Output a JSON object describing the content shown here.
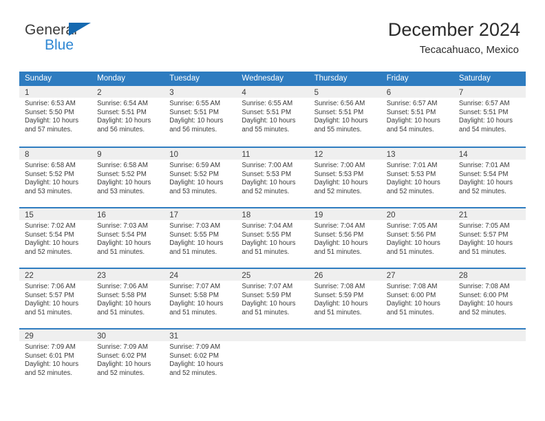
{
  "brand": {
    "line1": "General",
    "line2": "Blue",
    "triangle_color": "#1569b0",
    "blue_text_color": "#2f87d3"
  },
  "header": {
    "title": "December 2024",
    "subtitle": "Tecacahuaco, Mexico"
  },
  "theme": {
    "header_blue": "#2e7cc0",
    "daynum_strip": "#efefef",
    "text": "#3a3a3a"
  },
  "weekdays": [
    "Sunday",
    "Monday",
    "Tuesday",
    "Wednesday",
    "Thursday",
    "Friday",
    "Saturday"
  ],
  "labels": {
    "sunrise_prefix": "Sunrise:",
    "sunset_prefix": "Sunset:",
    "daylight_prefix": "Daylight:"
  },
  "weeks": [
    [
      {
        "day": "1",
        "sunrise": "Sunrise: 6:53 AM",
        "sunset": "Sunset: 5:50 PM",
        "daylight1": "Daylight: 10 hours",
        "daylight2": "and 57 minutes."
      },
      {
        "day": "2",
        "sunrise": "Sunrise: 6:54 AM",
        "sunset": "Sunset: 5:51 PM",
        "daylight1": "Daylight: 10 hours",
        "daylight2": "and 56 minutes."
      },
      {
        "day": "3",
        "sunrise": "Sunrise: 6:55 AM",
        "sunset": "Sunset: 5:51 PM",
        "daylight1": "Daylight: 10 hours",
        "daylight2": "and 56 minutes."
      },
      {
        "day": "4",
        "sunrise": "Sunrise: 6:55 AM",
        "sunset": "Sunset: 5:51 PM",
        "daylight1": "Daylight: 10 hours",
        "daylight2": "and 55 minutes."
      },
      {
        "day": "5",
        "sunrise": "Sunrise: 6:56 AM",
        "sunset": "Sunset: 5:51 PM",
        "daylight1": "Daylight: 10 hours",
        "daylight2": "and 55 minutes."
      },
      {
        "day": "6",
        "sunrise": "Sunrise: 6:57 AM",
        "sunset": "Sunset: 5:51 PM",
        "daylight1": "Daylight: 10 hours",
        "daylight2": "and 54 minutes."
      },
      {
        "day": "7",
        "sunrise": "Sunrise: 6:57 AM",
        "sunset": "Sunset: 5:51 PM",
        "daylight1": "Daylight: 10 hours",
        "daylight2": "and 54 minutes."
      }
    ],
    [
      {
        "day": "8",
        "sunrise": "Sunrise: 6:58 AM",
        "sunset": "Sunset: 5:52 PM",
        "daylight1": "Daylight: 10 hours",
        "daylight2": "and 53 minutes."
      },
      {
        "day": "9",
        "sunrise": "Sunrise: 6:58 AM",
        "sunset": "Sunset: 5:52 PM",
        "daylight1": "Daylight: 10 hours",
        "daylight2": "and 53 minutes."
      },
      {
        "day": "10",
        "sunrise": "Sunrise: 6:59 AM",
        "sunset": "Sunset: 5:52 PM",
        "daylight1": "Daylight: 10 hours",
        "daylight2": "and 53 minutes."
      },
      {
        "day": "11",
        "sunrise": "Sunrise: 7:00 AM",
        "sunset": "Sunset: 5:53 PM",
        "daylight1": "Daylight: 10 hours",
        "daylight2": "and 52 minutes."
      },
      {
        "day": "12",
        "sunrise": "Sunrise: 7:00 AM",
        "sunset": "Sunset: 5:53 PM",
        "daylight1": "Daylight: 10 hours",
        "daylight2": "and 52 minutes."
      },
      {
        "day": "13",
        "sunrise": "Sunrise: 7:01 AM",
        "sunset": "Sunset: 5:53 PM",
        "daylight1": "Daylight: 10 hours",
        "daylight2": "and 52 minutes."
      },
      {
        "day": "14",
        "sunrise": "Sunrise: 7:01 AM",
        "sunset": "Sunset: 5:54 PM",
        "daylight1": "Daylight: 10 hours",
        "daylight2": "and 52 minutes."
      }
    ],
    [
      {
        "day": "15",
        "sunrise": "Sunrise: 7:02 AM",
        "sunset": "Sunset: 5:54 PM",
        "daylight1": "Daylight: 10 hours",
        "daylight2": "and 52 minutes."
      },
      {
        "day": "16",
        "sunrise": "Sunrise: 7:03 AM",
        "sunset": "Sunset: 5:54 PM",
        "daylight1": "Daylight: 10 hours",
        "daylight2": "and 51 minutes."
      },
      {
        "day": "17",
        "sunrise": "Sunrise: 7:03 AM",
        "sunset": "Sunset: 5:55 PM",
        "daylight1": "Daylight: 10 hours",
        "daylight2": "and 51 minutes."
      },
      {
        "day": "18",
        "sunrise": "Sunrise: 7:04 AM",
        "sunset": "Sunset: 5:55 PM",
        "daylight1": "Daylight: 10 hours",
        "daylight2": "and 51 minutes."
      },
      {
        "day": "19",
        "sunrise": "Sunrise: 7:04 AM",
        "sunset": "Sunset: 5:56 PM",
        "daylight1": "Daylight: 10 hours",
        "daylight2": "and 51 minutes."
      },
      {
        "day": "20",
        "sunrise": "Sunrise: 7:05 AM",
        "sunset": "Sunset: 5:56 PM",
        "daylight1": "Daylight: 10 hours",
        "daylight2": "and 51 minutes."
      },
      {
        "day": "21",
        "sunrise": "Sunrise: 7:05 AM",
        "sunset": "Sunset: 5:57 PM",
        "daylight1": "Daylight: 10 hours",
        "daylight2": "and 51 minutes."
      }
    ],
    [
      {
        "day": "22",
        "sunrise": "Sunrise: 7:06 AM",
        "sunset": "Sunset: 5:57 PM",
        "daylight1": "Daylight: 10 hours",
        "daylight2": "and 51 minutes."
      },
      {
        "day": "23",
        "sunrise": "Sunrise: 7:06 AM",
        "sunset": "Sunset: 5:58 PM",
        "daylight1": "Daylight: 10 hours",
        "daylight2": "and 51 minutes."
      },
      {
        "day": "24",
        "sunrise": "Sunrise: 7:07 AM",
        "sunset": "Sunset: 5:58 PM",
        "daylight1": "Daylight: 10 hours",
        "daylight2": "and 51 minutes."
      },
      {
        "day": "25",
        "sunrise": "Sunrise: 7:07 AM",
        "sunset": "Sunset: 5:59 PM",
        "daylight1": "Daylight: 10 hours",
        "daylight2": "and 51 minutes."
      },
      {
        "day": "26",
        "sunrise": "Sunrise: 7:08 AM",
        "sunset": "Sunset: 5:59 PM",
        "daylight1": "Daylight: 10 hours",
        "daylight2": "and 51 minutes."
      },
      {
        "day": "27",
        "sunrise": "Sunrise: 7:08 AM",
        "sunset": "Sunset: 6:00 PM",
        "daylight1": "Daylight: 10 hours",
        "daylight2": "and 51 minutes."
      },
      {
        "day": "28",
        "sunrise": "Sunrise: 7:08 AM",
        "sunset": "Sunset: 6:00 PM",
        "daylight1": "Daylight: 10 hours",
        "daylight2": "and 52 minutes."
      }
    ],
    [
      {
        "day": "29",
        "sunrise": "Sunrise: 7:09 AM",
        "sunset": "Sunset: 6:01 PM",
        "daylight1": "Daylight: 10 hours",
        "daylight2": "and 52 minutes."
      },
      {
        "day": "30",
        "sunrise": "Sunrise: 7:09 AM",
        "sunset": "Sunset: 6:02 PM",
        "daylight1": "Daylight: 10 hours",
        "daylight2": "and 52 minutes."
      },
      {
        "day": "31",
        "sunrise": "Sunrise: 7:09 AM",
        "sunset": "Sunset: 6:02 PM",
        "daylight1": "Daylight: 10 hours",
        "daylight2": "and 52 minutes."
      },
      {
        "day": "",
        "sunrise": "",
        "sunset": "",
        "daylight1": "",
        "daylight2": ""
      },
      {
        "day": "",
        "sunrise": "",
        "sunset": "",
        "daylight1": "",
        "daylight2": ""
      },
      {
        "day": "",
        "sunrise": "",
        "sunset": "",
        "daylight1": "",
        "daylight2": ""
      },
      {
        "day": "",
        "sunrise": "",
        "sunset": "",
        "daylight1": "",
        "daylight2": ""
      }
    ]
  ]
}
